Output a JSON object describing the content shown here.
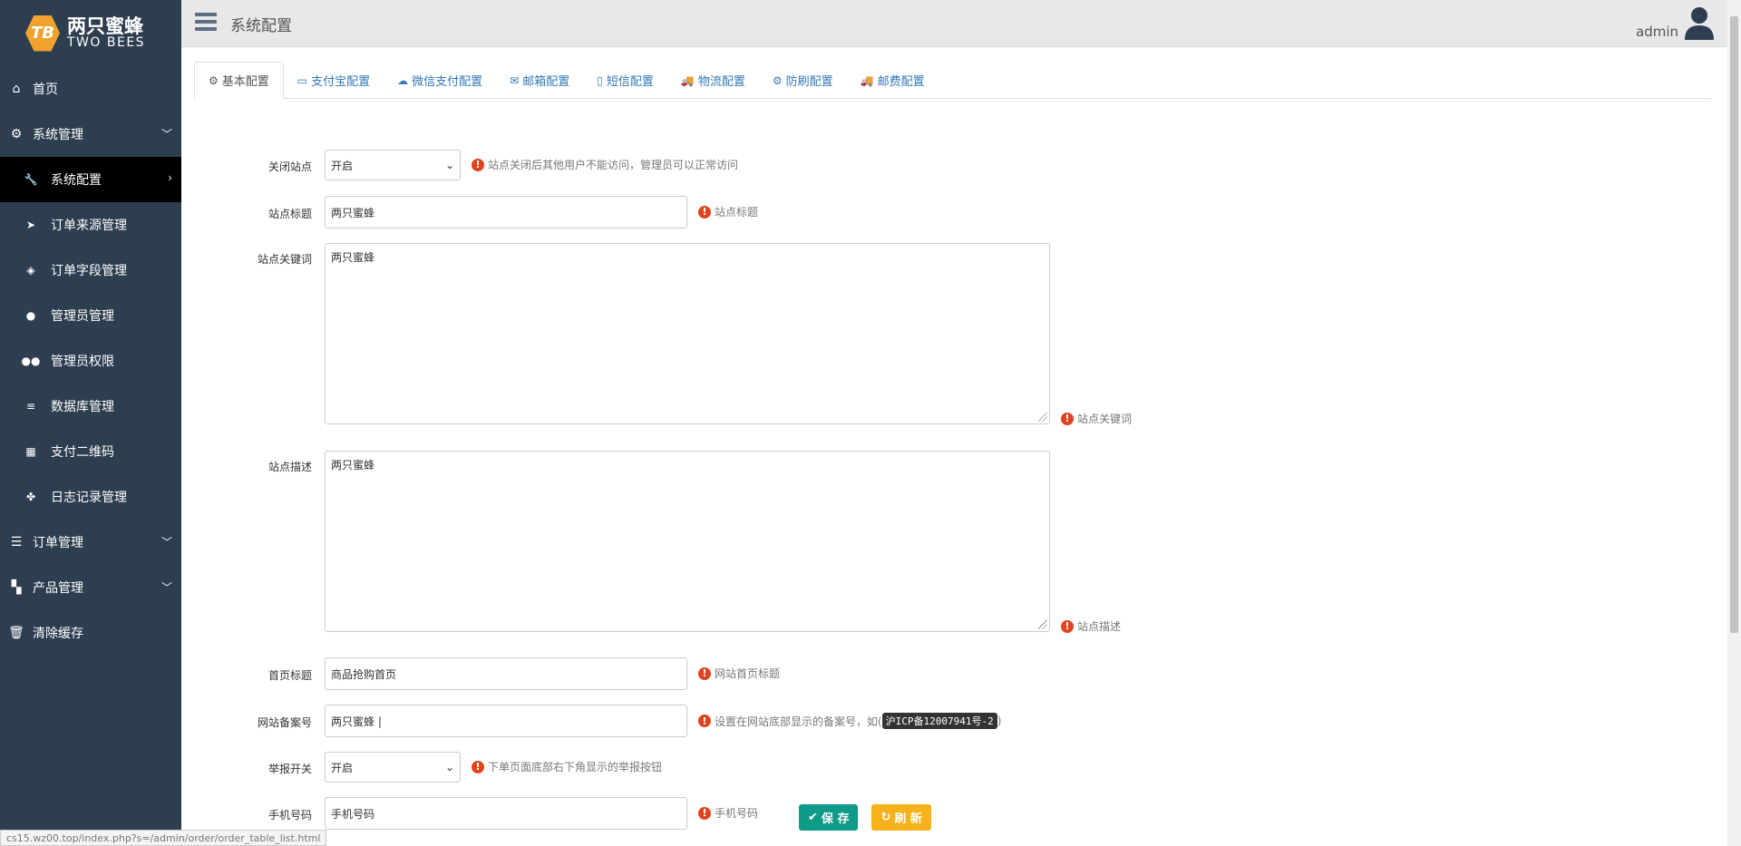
{
  "brand": {
    "cn": "两只蜜蜂",
    "en": "TWO BEES",
    "mark": "TB"
  },
  "sidebar": {
    "items": [
      {
        "label": "首页",
        "icon": "home-icon"
      },
      {
        "label": "系统管理",
        "icon": "gear-icon",
        "expandable": true
      },
      {
        "label": "系统配置",
        "icon": "wrench-icon",
        "sub": true,
        "active": true
      },
      {
        "label": "订单来源管理",
        "icon": "location-arrow-icon",
        "sub": true
      },
      {
        "label": "订单字段管理",
        "icon": "tags-icon",
        "sub": true
      },
      {
        "label": "管理员管理",
        "icon": "user-icon",
        "sub": true
      },
      {
        "label": "管理员权限",
        "icon": "users-icon",
        "sub": true
      },
      {
        "label": "数据库管理",
        "icon": "database-icon",
        "sub": true
      },
      {
        "label": "支付二维码",
        "icon": "qrcode-icon",
        "sub": true
      },
      {
        "label": "日志记录管理",
        "icon": "paw-icon",
        "sub": true
      },
      {
        "label": "订单管理",
        "icon": "list-icon",
        "expandable": true
      },
      {
        "label": "产品管理",
        "icon": "grid-icon",
        "expandable": true
      },
      {
        "label": "清除缓存",
        "icon": "trash-icon"
      }
    ]
  },
  "header": {
    "title": "系统配置",
    "user": "admin"
  },
  "tabs": [
    {
      "label": "基本配置",
      "icon": "gears-icon",
      "active": true
    },
    {
      "label": "支付宝配置",
      "icon": "credit-card-icon"
    },
    {
      "label": "微信支付配置",
      "icon": "wechat-icon"
    },
    {
      "label": "邮箱配置",
      "icon": "envelope-icon"
    },
    {
      "label": "短信配置",
      "icon": "mobile-icon"
    },
    {
      "label": "物流配置",
      "icon": "truck-icon"
    },
    {
      "label": "防刷配置",
      "icon": "gear-icon"
    },
    {
      "label": "邮费配置",
      "icon": "truck-icon"
    }
  ],
  "form": {
    "close_site": {
      "label": "关闭站点",
      "value": "开启",
      "hint": "站点关闭后其他用户不能访问，管理员可以正常访问"
    },
    "site_title": {
      "label": "站点标题",
      "value": "两只蜜蜂",
      "hint": "站点标题"
    },
    "site_keywords": {
      "label": "站点关键词",
      "value": "两只蜜蜂",
      "hint": "站点关键词"
    },
    "site_desc": {
      "label": "站点描述",
      "value": "两只蜜蜂",
      "hint": "站点描述"
    },
    "home_title": {
      "label": "首页标题",
      "value": "商品抢购首页",
      "hint": "网站首页标题"
    },
    "icp": {
      "label": "网站备案号",
      "value": "两只蜜蜂 |",
      "hint_prefix": "设置在网站底部显示的备案号，如(",
      "hint_code": "沪ICP备12007941号-2",
      "hint_suffix": ")"
    },
    "report": {
      "label": "举报开关",
      "value": "开启",
      "hint": "下单页面底部右下角显示的举报按钮"
    },
    "phone": {
      "label": "手机号码",
      "value": "手机号码",
      "hint": "手机号码"
    }
  },
  "buttons": {
    "save": "保 存",
    "refresh": "刷 新"
  },
  "status_url": "cs15.wz00.top/index.php?s=/admin/order/order_table_list.html"
}
